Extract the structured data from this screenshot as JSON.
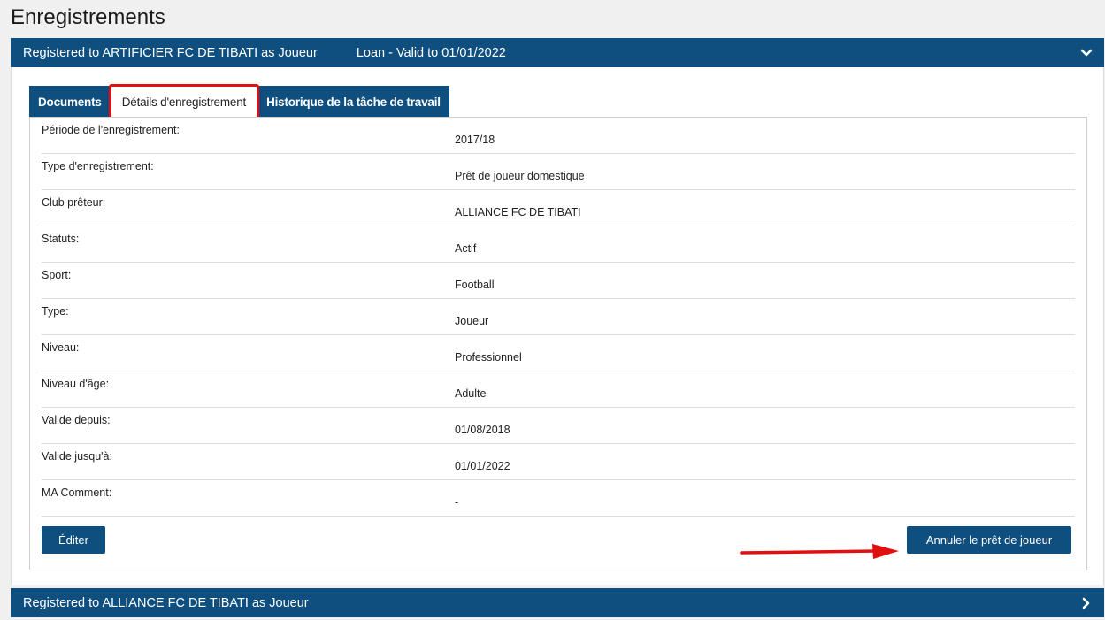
{
  "page": {
    "title": "Enregistrements"
  },
  "registrations": [
    {
      "header": "Registered to ARTIFICIER FC DE TIBATI as Joueur",
      "loan": "Loan - Valid to 01/01/2022",
      "expanded": true,
      "chevron_icon": "chevron-down-icon"
    },
    {
      "header": "Registered to ALLIANCE FC DE TIBATI as Joueur",
      "expanded": false,
      "chevron_icon": "chevron-right-icon"
    }
  ],
  "tabs": [
    {
      "label": "Documents",
      "active": false
    },
    {
      "label": "Détails d'enregistrement",
      "active": true
    },
    {
      "label": "Historique de la tâche de travail",
      "active": false
    }
  ],
  "details": [
    {
      "label": "Période de l'enregistrement:",
      "value": "2017/18"
    },
    {
      "label": "Type d'enregistrement:",
      "value": "Prêt de joueur domestique"
    },
    {
      "label": "Club prêteur:",
      "value": "ALLIANCE FC DE TIBATI"
    },
    {
      "label": "Statuts:",
      "value": "Actif"
    },
    {
      "label": "Sport:",
      "value": "Football"
    },
    {
      "label": "Type:",
      "value": "Joueur"
    },
    {
      "label": "Niveau:",
      "value": "Professionnel"
    },
    {
      "label": "Niveau d'âge:",
      "value": "Adulte"
    },
    {
      "label": "Valide depuis:",
      "value": "01/08/2018"
    },
    {
      "label": "Valide jusqu'à:",
      "value": "01/01/2022"
    },
    {
      "label": "MA Comment:",
      "value": "-"
    }
  ],
  "actions": {
    "edit_label": "Éditer",
    "cancel_loan_label": "Annuler le prêt de joueur"
  },
  "colors": {
    "header_bg": "#0f4f80",
    "highlight": "#e01010",
    "page_bg": "#f0f0f0"
  }
}
